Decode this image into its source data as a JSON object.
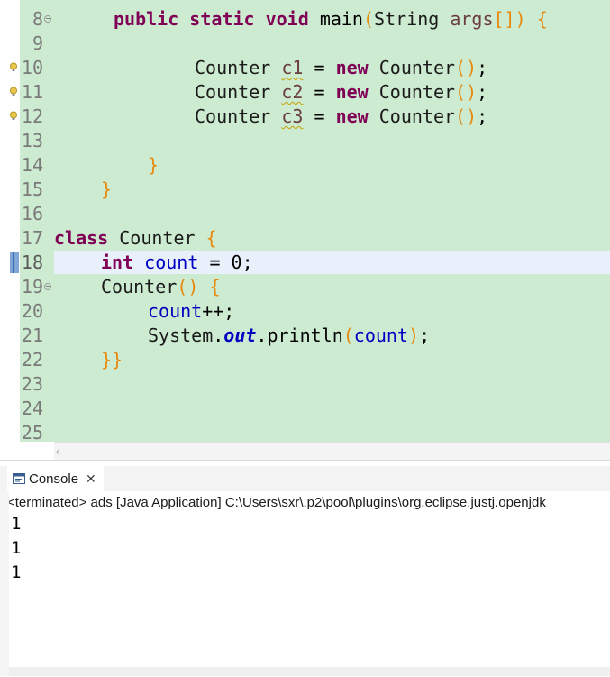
{
  "editor": {
    "line_numbers": [
      "8",
      "9",
      "10",
      "11",
      "12",
      "13",
      "14",
      "15",
      "16",
      "17",
      "18",
      "19",
      "20",
      "21",
      "22",
      "23",
      "24",
      "25"
    ],
    "lines": {
      "l8": {
        "kw1": "public",
        "kw2": "static",
        "kw3": "void",
        "name": "main",
        "open": "(",
        "type": "String",
        "arg": "args",
        "arr": "[]",
        "close": ")",
        "brace": "{"
      },
      "l10": {
        "type": "Counter",
        "var": "c1",
        "eq": "=",
        "kw": "new",
        "ctor": "Counter",
        "parens": "()",
        "semi": ";"
      },
      "l11": {
        "type": "Counter",
        "var": "c2",
        "eq": "=",
        "kw": "new",
        "ctor": "Counter",
        "parens": "()",
        "semi": ";"
      },
      "l12": {
        "type": "Counter",
        "var": "c3",
        "eq": "=",
        "kw": "new",
        "ctor": "Counter",
        "parens": "()",
        "semi": ";"
      },
      "l14": {
        "brace": "}"
      },
      "l15": {
        "brace": "}"
      },
      "l17": {
        "kw": "class",
        "name": "Counter",
        "brace": "{"
      },
      "l18": {
        "kw": "int",
        "field": "count",
        "eq": "=",
        "val": "0",
        "semi": ";"
      },
      "l19": {
        "name": "Counter",
        "parens": "()",
        "brace": "{"
      },
      "l20": {
        "field": "count",
        "op": "++;"
      },
      "l21": {
        "cls": "System",
        "dot": ".",
        "sfield": "out",
        "method": ".println",
        "open": "(",
        "field": "count",
        "close": ")",
        "semi": ";"
      },
      "l22": {
        "braces": "}}"
      }
    },
    "warning_lines": [
      "10",
      "11",
      "12"
    ],
    "current_line": "18"
  },
  "console": {
    "tab_label": "Console",
    "close_glyph": "✕",
    "status": "<terminated> ads [Java Application] C:\\Users\\sxr\\.p2\\pool\\plugins\\org.eclipse.justj.openjdk",
    "output": [
      "1",
      "1",
      "1"
    ]
  },
  "colors": {
    "editor_bg": "#cdebd1",
    "keyword": "#7f0055",
    "bracket": "#e6890e",
    "field": "#0000c0",
    "current_line": "#e8f0fb"
  },
  "icons": {
    "scroll_left": "‹"
  }
}
